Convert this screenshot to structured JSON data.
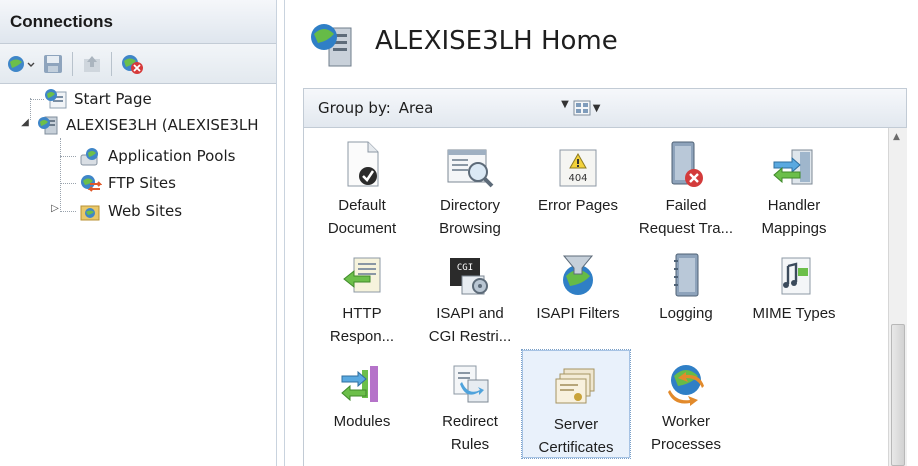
{
  "connections": {
    "title": "Connections",
    "toolbar": [
      "connect-icon",
      "save-icon",
      "up-icon",
      "disconnect-icon"
    ],
    "tree": [
      {
        "label": "Start Page",
        "icon": "start-page-icon"
      },
      {
        "label": "ALEXISE3LH (ALEXISE3LH",
        "icon": "server-icon"
      },
      {
        "label": "Application Pools",
        "icon": "app-pool-icon"
      },
      {
        "label": "FTP Sites",
        "icon": "ftp-sites-icon"
      },
      {
        "label": "Web Sites",
        "icon": "web-sites-icon"
      }
    ]
  },
  "home": {
    "title": "ALEXISE3LH Home",
    "group_by_label": "Group by:",
    "group_by_value": "Area"
  },
  "features": [
    {
      "label": "Default\nDocument",
      "icon": "default-document-icon"
    },
    {
      "label": "Directory\nBrowsing",
      "icon": "directory-browsing-icon"
    },
    {
      "label": "Error Pages",
      "icon": "error-pages-icon",
      "badge": "404"
    },
    {
      "label": "Failed\nRequest Tra...",
      "icon": "failed-request-icon"
    },
    {
      "label": "Handler\nMappings",
      "icon": "handler-mappings-icon"
    },
    {
      "label": "HTTP\nRespon...",
      "icon": "http-response-icon"
    },
    {
      "label": "ISAPI and\nCGI Restri...",
      "icon": "isapi-cgi-icon",
      "badge": "CGI"
    },
    {
      "label": "ISAPI Filters",
      "icon": "isapi-filters-icon"
    },
    {
      "label": "Logging",
      "icon": "logging-icon"
    },
    {
      "label": "MIME Types",
      "icon": "mime-types-icon"
    },
    {
      "label": "Modules",
      "icon": "modules-icon"
    },
    {
      "label": "Redirect\nRules",
      "icon": "redirect-rules-icon"
    },
    {
      "label": "Server\nCertificates",
      "icon": "server-certificates-icon"
    },
    {
      "label": "Worker\nProcesses",
      "icon": "worker-processes-icon"
    }
  ]
}
